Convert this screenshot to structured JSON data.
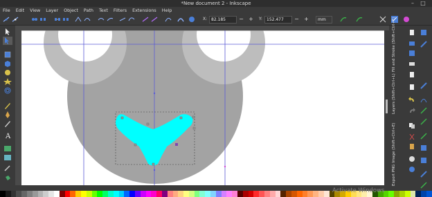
{
  "window": {
    "title": "*New document 2 - Inkscape"
  },
  "menu": [
    "File",
    "Edit",
    "View",
    "Layer",
    "Object",
    "Path",
    "Text",
    "Filters",
    "Extensions",
    "Help"
  ],
  "toolbar": {
    "x_label": "X:",
    "x_value": "82.185",
    "y_label": "Y:",
    "y_value": "152.477",
    "unit": "mm"
  },
  "docks": {
    "fill_stroke": "Fill and Stroke (Shift+Ctrl+F)",
    "layers": "Layers (Shift+Ctrl+L)",
    "export": "Export PNG Image (Shift+Ctrl+E)"
  },
  "watermark": "Activate Windows",
  "colors": {
    "chrome": "#3a3a3a",
    "shape_gray": "#a3a3a3",
    "eye_ring": "#bdbdbd",
    "cyan": "#00ffff",
    "guide": "#5b5bd6",
    "accent": "#4a7fd8"
  },
  "palette": [
    "#000000",
    "#1a1a1a",
    "#333333",
    "#4d4d4d",
    "#666666",
    "#808080",
    "#999999",
    "#b3b3b3",
    "#cccccc",
    "#e6e6e6",
    "#ffffff",
    "#800000",
    "#ff0000",
    "#ff6600",
    "#ffcc00",
    "#ffff00",
    "#ccff00",
    "#66ff00",
    "#00ff00",
    "#00ff66",
    "#00ffcc",
    "#00ffff",
    "#00ccff",
    "#0066ff",
    "#0000ff",
    "#6600ff",
    "#cc00ff",
    "#ff00ff",
    "#ff00cc",
    "#ff0066",
    "#800080",
    "#ff8080",
    "#ffaa80",
    "#ffd480",
    "#ffff80",
    "#d4ff80",
    "#80ff80",
    "#80ffd4",
    "#80ffff",
    "#80d4ff",
    "#8080ff",
    "#d480ff",
    "#ff80ff",
    "#ff80d4",
    "#550000",
    "#aa0000",
    "#d40000",
    "#ff2a2a",
    "#ff5555",
    "#ff8080",
    "#ffaaaa",
    "#ffd5d5",
    "#552200",
    "#aa4400",
    "#d45500",
    "#ff6600",
    "#ff7f2a",
    "#ff9955",
    "#ffb380",
    "#ffccaa",
    "#ffe6d5",
    "#554400",
    "#aa8800",
    "#d4aa00",
    "#ffcc00",
    "#ffdd55",
    "#ffe680",
    "#ffeeaa",
    "#fff6d5",
    "#225500",
    "#44aa00",
    "#55d400",
    "#66ff00",
    "#88aa00",
    "#aad400",
    "#ccff00",
    "#dde6aa",
    "#002255",
    "#0044aa",
    "#0055d4"
  ]
}
